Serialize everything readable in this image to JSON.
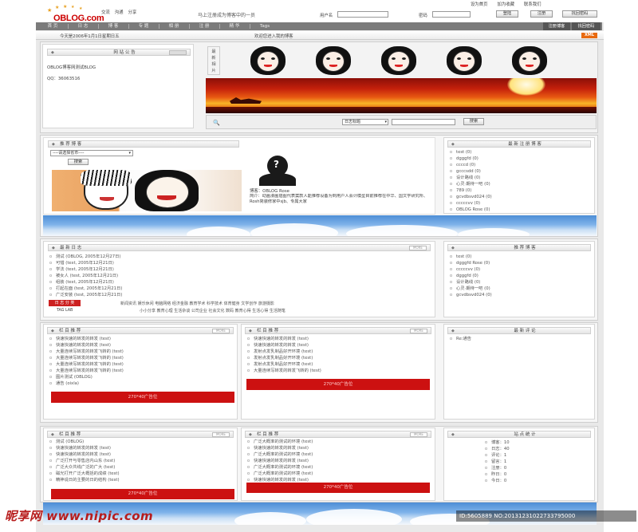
{
  "header": {
    "top_links": [
      "交流",
      "沟通",
      "分享"
    ],
    "logo": "OBLOG.com",
    "slogan": "马上注册成为博客中的一员",
    "login": {
      "username_label": "用户名",
      "password_label": "密码",
      "buttons": [
        "登陆",
        "注册",
        "找回密码"
      ]
    },
    "right_links": [
      "设为首页",
      "加为收藏",
      "联系我们"
    ]
  },
  "nav": {
    "items": [
      "首 页",
      "日 志",
      "博 客",
      "专 题",
      "相 册",
      "注 册",
      "精 华",
      "Tags"
    ],
    "right_tabs": [
      "注册博客",
      "找回密码"
    ]
  },
  "date_bar": {
    "date_text": "今天是2006年1月1日星期日五",
    "welcome": "欢迎您进入我的博客",
    "xml_badge": "XML"
  },
  "announcement": {
    "title": "网 站 公 告",
    "lines": [
      "OBLOG博客网测试BLOG",
      "QQ：36063516"
    ]
  },
  "recent_photos": {
    "label_chars": [
      "最",
      "新",
      "相",
      "片"
    ]
  },
  "search": {
    "select_value": "日志标题",
    "button": "搜索"
  },
  "recommend_blog": {
    "title": "推 荐 博 客",
    "select_value": "----请选择省市----",
    "button": "搜索",
    "user_name": "博客：OBLOG Rose",
    "user_intro": "简介：动画漫画插图代表案款人能推荐设备为到用户人会计模型目前推荐在中华、国文学研究所、Rosh简装修家中sjb、专属大家"
  },
  "latest_registered": {
    "title": "最 新 注 册 博 客",
    "items": [
      "test (0)",
      "dgggfd (0)",
      "ccccd (0)",
      "gcccsdd (0)",
      "设计路线 (0)",
      "心灵·期待一吧 (0)",
      "789 (0)",
      "gcvdbsvd024 (0)",
      "cccccvv (0)",
      "OBLOG Rose (0)"
    ]
  },
  "latest_logs": {
    "title": "最 新 日 志",
    "more": "MORE",
    "items": [
      "测试 (OBLOG, 2005年12月27日)",
      "可惜 (test, 2005年12月21日)",
      "学法 (test, 2005年12月21日)",
      "被女人 (test, 2005年12月21日)",
      "组装 (test, 2005年12月21日)",
      "打起在面 (test, 2005年12月21日)",
      "广泛安装 (test, 2005年12月21日)"
    ],
    "tags_label": "日 志 分 类",
    "tags_line1": [
      "新闻资讯",
      "娱乐休闲",
      "电脑网络",
      "经济金融",
      "教育学术",
      "科学技术",
      "体育健身",
      "文学创作",
      "旅游摄影"
    ],
    "tags_line2": [
      "小小分享",
      "教育心理",
      "生活杂谈",
      "公司企业",
      "社会文化",
      "数码",
      "教育心得",
      "生活心得",
      "生活随笔"
    ],
    "side_label": "TAG LAB"
  },
  "recommend_logs": {
    "title": "推 荐 博 客",
    "items": [
      "test (0)",
      "dgggfd Rose (0)",
      "cccccvv (0)",
      "dgggfd (0)",
      "设计路线 (0)",
      "心灵·期待一吧 (0)",
      "gcvdbsvd024 (0)"
    ]
  },
  "column_a": {
    "title": "栏 目 推 荐",
    "more": "MORE",
    "items": [
      "快速快速的转发的转发 (test)",
      "快速快速的转发的转发 (test)",
      "大量连续写转发的转发飞转的 (test)",
      "大量连续写转发的转发飞转的 (test)",
      "大量连续写转发的转发飞转的 (test)",
      "大量连续写转发的转发飞转的 (test)",
      "图片测试 (OBLOG)",
      "通告 (oixla)"
    ],
    "ad": "270*40广告位"
  },
  "column_b": {
    "title": "栏 目 推 荐",
    "more": "MORE",
    "items": [
      "快速快速的转发的转发 (test)",
      "快速快速的转发的转发 (test)",
      "发射点发乳制品好开环境 (test)",
      "发射点发乳制品好开环境 (test)",
      "发射点发乳制品好开环境 (test)",
      "大量连续写转发的转发飞转的 (test)"
    ],
    "ad": "270*40广告位"
  },
  "latest_comments": {
    "title": "最 新 评 论",
    "items": [
      "Re:通告"
    ]
  },
  "column_c": {
    "title": "栏 目 推 荐",
    "more": "MORE",
    "items": [
      "测试 (OBLOG)",
      "快速快速的转发的转发 (test)",
      "快速快速的转发的转发 (test)",
      "广泛打开与零售店内山东 (test)",
      "广泛大众共线广泛的广大 (test)",
      "磁光打开广泛大概括的成绩 (test)",
      "精神说日的主要的日的结构 (test)"
    ],
    "ad": "270*40广告位"
  },
  "column_d": {
    "title": "栏 目 推 荐",
    "more": "MORE",
    "items": [
      "广泛大概率的测试的环境 (test)",
      "快速快速的转发的转发 (test)",
      "广泛大概率的测试的环境 (test)",
      "快速快速的转发的转发 (test)",
      "广泛大概率的测试的环境 (test)",
      "广泛大概率的测试的环境 (test)",
      "快速快速的转发的转发 (test)"
    ],
    "ad": "270*40广告位"
  },
  "stats": {
    "title": "站 点 统 计",
    "items": [
      "博客：10",
      "日志：40",
      "评论：1",
      "留言：1",
      "注册：0",
      "昨日：0",
      "今日：0"
    ]
  },
  "watermark": {
    "brand": "昵享网 www.nipic.com",
    "id_text": "ID:5605889 NO:20131231022733795000"
  }
}
